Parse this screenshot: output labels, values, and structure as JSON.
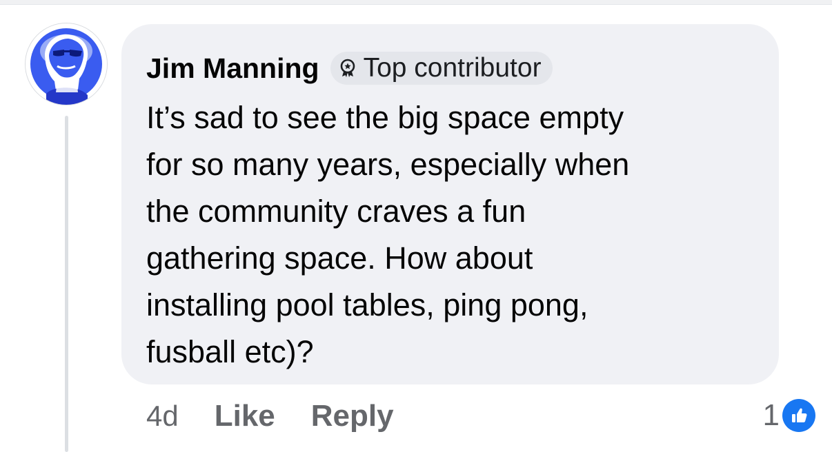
{
  "comment": {
    "author": "Jim Manning",
    "badge": "Top contributor",
    "badge_icon": "top-contributor-badge-icon",
    "text": "It’s sad to see the big space empty\nfor so many years, especially when\nthe community craves a fun\ngathering space. How about\ninstalling pool tables, ping pong,\nfusball etc)?",
    "timestamp": "4d",
    "actions": {
      "like": "Like",
      "reply": "Reply"
    },
    "reactions": {
      "count": "1",
      "icon": "like-reaction-icon",
      "color": "#1877f2"
    },
    "avatar_color": "#2a4de8"
  }
}
